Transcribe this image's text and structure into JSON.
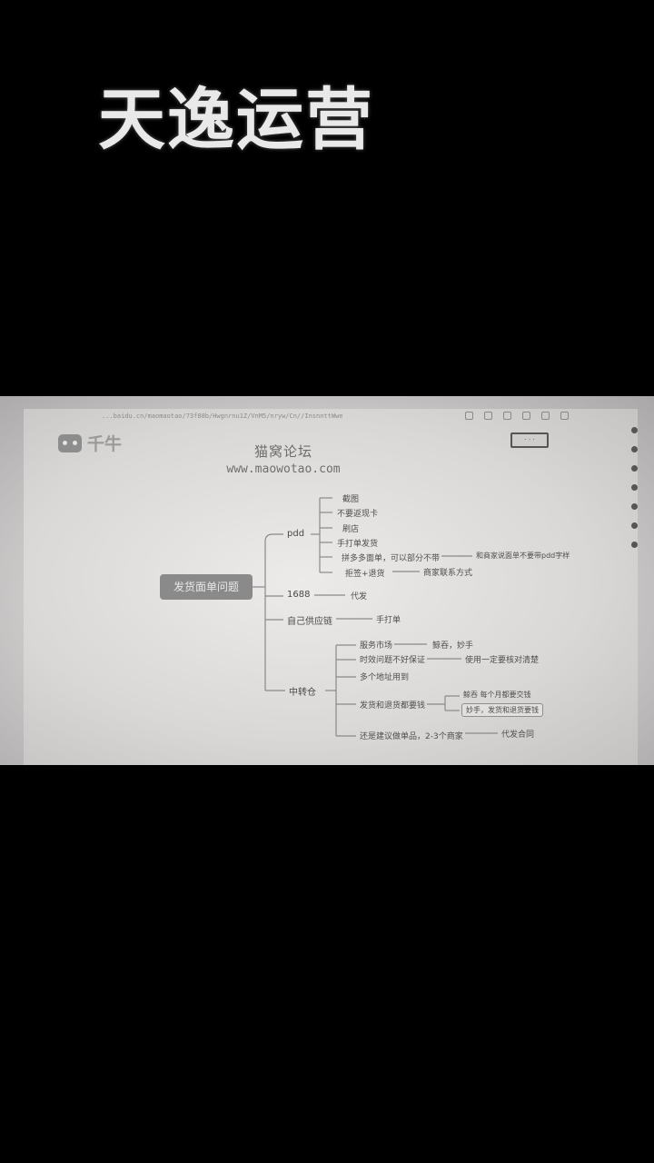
{
  "overlay_title": "天逸运营",
  "browser": {
    "url": "...baidu.cn/maomaotao/73f88b/Hwgnrnu1Z/VnM5/nryw/Cn//InsnnttWwe"
  },
  "app_logo": {
    "text": "千牛"
  },
  "top_button": "· · ·",
  "watermark": {
    "name": "猫窝论坛",
    "url": "www.maowotao.com"
  },
  "mindmap": {
    "root": "发货面单问题",
    "branches": {
      "pdd": {
        "label": "pdd",
        "children": [
          "截图",
          "不要返现卡",
          "刷店",
          "手打单发货",
          "拼多多面单，可以部分不带",
          "拒签+退货"
        ],
        "notes": {
          "pinduoduo": "和商家说面单不要带pdd字样",
          "reject": "商家联系方式"
        }
      },
      "b1688": {
        "label": "1688",
        "note": "代发"
      },
      "own_supply": {
        "label": "自己供应链",
        "note": "手打单"
      },
      "transfer": {
        "label": "中转仓",
        "children": [
          "服务市场",
          "时效问题不好保证",
          "多个地址用到",
          "发货和退货都要钱",
          "还是建议做单品，2-3个商家"
        ],
        "notes": {
          "service": "鲸吞，妙手",
          "timeliness": "使用一定要核对清楚",
          "jingtun": "鲸吞   每个月都要交钱",
          "miaoshou": "妙手，发货和退货要钱",
          "single": "代发合同"
        }
      }
    }
  }
}
